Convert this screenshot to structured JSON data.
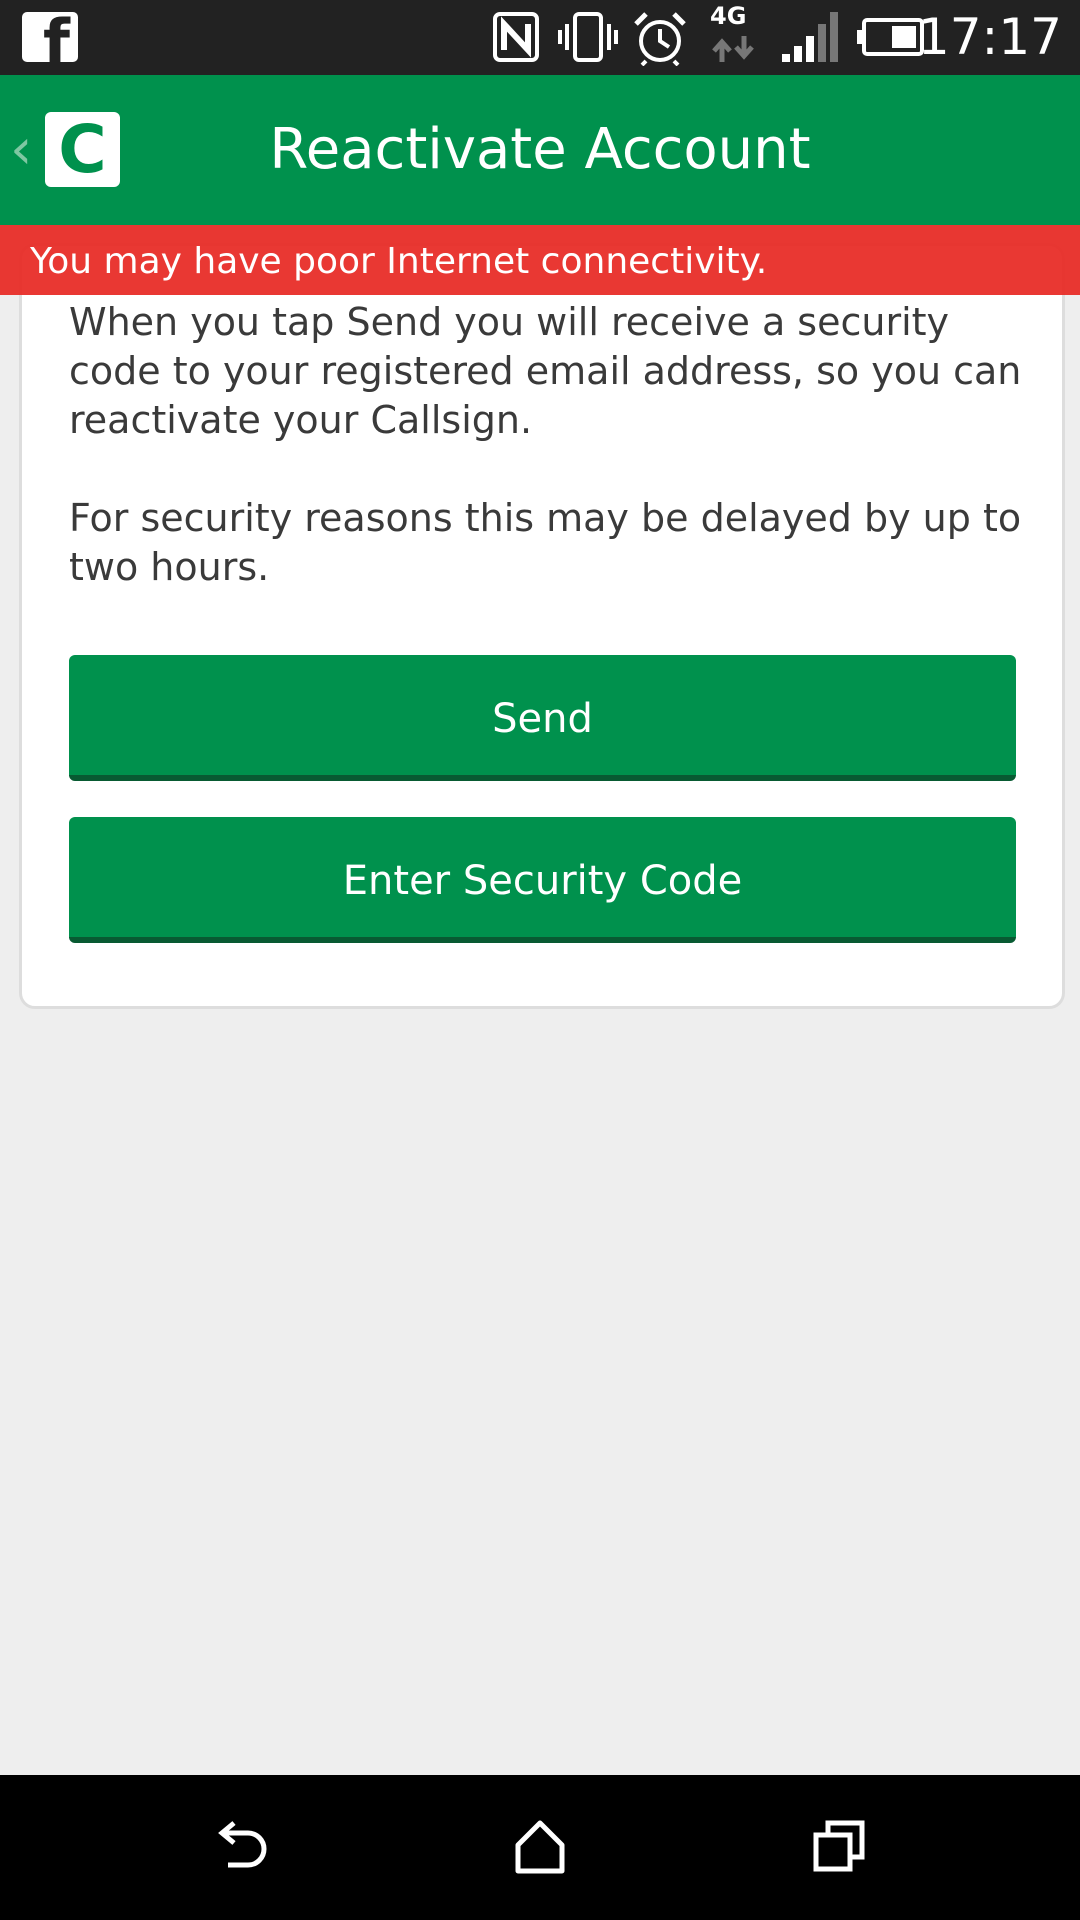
{
  "status_bar": {
    "time": "17:17",
    "network": "4G",
    "icons": [
      "facebook-icon",
      "nfc-icon",
      "vibrate-icon",
      "alarm-icon",
      "network-4g-icon",
      "signal-icon",
      "battery-icon"
    ]
  },
  "app_bar": {
    "title": "Reactivate Account",
    "logo_letter": "C",
    "back_glyph": "‹"
  },
  "warning": {
    "text": "You may have poor Internet connectivity."
  },
  "card": {
    "paragraph1": "When you tap Send you will receive a security code to your registered email address, so you can reactivate your Callsign.",
    "paragraph2": "For security reasons this may be delayed by up to two hours.",
    "send_label": "Send",
    "enter_code_label": "Enter Security Code"
  },
  "nav_bar": {
    "icons": [
      "back-icon",
      "home-icon",
      "recents-icon"
    ]
  },
  "colors": {
    "brand_green": "#00914d",
    "warning_red": "#e82c26",
    "status_bar": "#222222"
  }
}
